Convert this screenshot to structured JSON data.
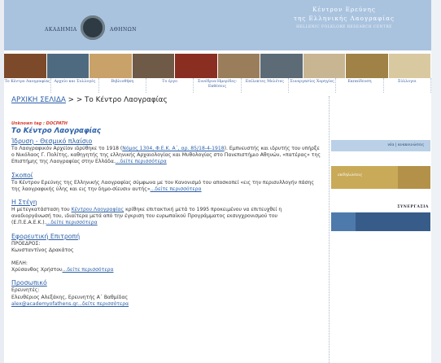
{
  "header": {
    "academy_name_left": "ΑΚΑΔΗΜΙΑ",
    "academy_name_right": "ΑΘΗΝΩΝ",
    "center_title_line1": "Κέντρον Ερεύνης",
    "center_title_line2": "της Ελληνικής Λαογραφίας",
    "center_subtitle": "HELLENIC FOLKLORE RESEARCH CENTRE",
    "photo_colors": [
      "#7c4a2a",
      "#4e6a80",
      "#c9a26a",
      "#6e5a46",
      "#8a2e22",
      "#9a7d5a",
      "#5c6b75",
      "#c8b692",
      "#a08246",
      "#d8c9a0"
    ]
  },
  "nav": {
    "items": [
      {
        "label": "Το Κέντρο Λαογραφίας"
      },
      {
        "label": "Αρχείο και Συλλογές"
      },
      {
        "label": "Βιβλιοθήκη"
      },
      {
        "label": "Το έργο"
      },
      {
        "label": "Συνέδρια-Ημερίδες-Εκθέσεις"
      },
      {
        "label": "Επίλεκτες Μελέτες"
      },
      {
        "label": "Συνεργασίες Χορηγίες"
      },
      {
        "label": "Εκπαίδευση"
      },
      {
        "label": "Σύλλογοι"
      }
    ]
  },
  "breadcrumb": {
    "home": "ΑΡΧΙΚΗ ΣΕΛΙΔΑ",
    "sep": " > > ",
    "current": "Το Κέντρο Λαογραφίας"
  },
  "content": {
    "tag": "Unknown tag : DOCPATH",
    "title": "Το Κέντρο Λαογραφίας",
    "sections": [
      {
        "heading": "Ίδρυση - Θεσμικό πλαίσιο",
        "text_before": "Το Λαογραφικόν Αρχείον ιδρύθηκε το 1918 (",
        "inline_link": "Νόμος 1304, Φ.Ε.Κ. Α΄, αρ. 85/18-4-1918",
        "text_after": "). Εμπνευστής και ιδρυτής του υπήρξε ο Νικόλαος Γ. Πολίτης, καθηγητής της ελληνικής Αρχαιολογίας και Μυθολογίας στο Πανεπιστήμιο Αθηνών, «πατέρας» της Επιστήμης της Λαογραφίας στην Ελλάδα.",
        "more": "...δείτε περισσότερα"
      },
      {
        "heading": "Σκοποί",
        "text": "Το Κέντρον Ερεύνης της Ελληνικής Λαογραφίας σύμφωνα με τον Κανονισμό του αποσκοπεί «εις την περισυλλογήν πάσης της λαογραφικής ύλης και εις την δημο-σίευσιν αυτής»",
        "more": "...δείτε περισσότερα"
      },
      {
        "heading": "Η Στέγη",
        "text_before": "Η μετεγκατάσταση του ",
        "inline_link": "Κέντρου Λαογραφίας",
        "text_after": " κρίθηκε επιτακτική μετά το 1995 προκειμένου να επιτευχθεί η αναδιοργάνωσή του, ιδιαίτερα μετά από την έγκριση του ευρωπαϊκού Προγράμματος εκσυγχρονισμού του (Ε.Π.Ε.Α.Ε.Κ.).",
        "more": "...δείτε περισσότερα"
      },
      {
        "heading": "Εφορευτική Επιτροπή",
        "line1": "ΠΡΟΕΔΡΟΣ:",
        "line2": "Κωνσταντίνος Δρακάτος",
        "line3": "ΜΕΛΗ:",
        "line4": "Χρύσανθος Χρήστου",
        "more": "...δείτε περισσότερα"
      },
      {
        "heading": "Προσωπικό",
        "line1": "Ερευνητές:",
        "line2": "Ελευθέριος Αλεξάκης, Ερευνητής Α΄ Βαθμίδας",
        "email": "alex@academyofathens.gr",
        "more": "...δείτε περισσότερα"
      }
    ]
  },
  "right_column": {
    "block1_label": "νέα | ανακοινώσεις",
    "block2_label": "εκδηλώσεις",
    "block3_heading": "ΣΥΝΕΡΓΑΣΙΑ"
  }
}
